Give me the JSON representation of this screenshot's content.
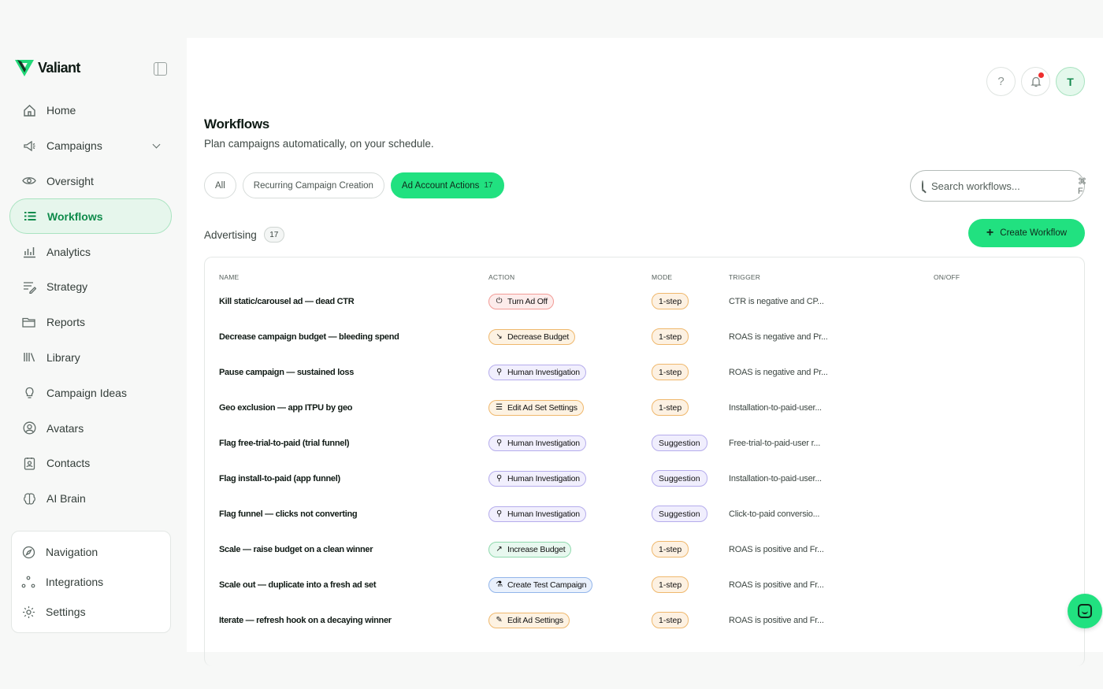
{
  "brand": {
    "name": "Valiant",
    "accent": "#21e180"
  },
  "sidebar": {
    "items": [
      {
        "label": "Home",
        "icon": "home-icon"
      },
      {
        "label": "Campaigns",
        "icon": "megaphone-icon"
      },
      {
        "label": "Oversight",
        "icon": "eye-icon"
      },
      {
        "label": "Workflows",
        "icon": "workflow-list-icon"
      },
      {
        "label": "Analytics",
        "icon": "bar-chart-icon"
      },
      {
        "label": "Strategy",
        "icon": "notes-pen-icon"
      },
      {
        "label": "Reports",
        "icon": "folder-icon"
      },
      {
        "label": "Library",
        "icon": "library-icon"
      },
      {
        "label": "Campaign Ideas",
        "icon": "lightbulb-icon"
      },
      {
        "label": "Avatars",
        "icon": "user-circle-icon"
      },
      {
        "label": "Contacts",
        "icon": "contact-card-icon"
      },
      {
        "label": "AI Brain",
        "icon": "brain-icon"
      }
    ],
    "bottom": [
      {
        "label": "Navigation",
        "icon": "compass-icon"
      },
      {
        "label": "Integrations",
        "icon": "nodes-icon"
      },
      {
        "label": "Settings",
        "icon": "gear-icon"
      }
    ]
  },
  "header": {
    "help": "?",
    "avatar_initial": "T"
  },
  "page": {
    "title": "Workflows",
    "subtitle": "Plan campaigns automatically, on your schedule."
  },
  "filters": [
    {
      "label": "All"
    },
    {
      "label": "Recurring Campaign Creation"
    },
    {
      "label": "Ad Account Actions",
      "count": "17"
    }
  ],
  "search": {
    "placeholder": "Search workflows...",
    "shortcut": "⌘ F"
  },
  "section": {
    "title": "Advertising",
    "count": "17"
  },
  "create_button": {
    "label": "Create Workflow"
  },
  "table": {
    "columns": [
      "NAME",
      "ACTION",
      "MODE",
      "TRIGGER",
      "ON/OFF"
    ],
    "rows": [
      {
        "name": "Kill static/carousel ad — dead CTR",
        "action": "Turn Ad Off",
        "action_icon": "power-off-icon",
        "mode": "1-step",
        "trigger": "CTR is negative and CP..."
      },
      {
        "name": "Decrease campaign budget — bleeding spend",
        "action": "Decrease Budget",
        "action_icon": "trend-down-icon",
        "mode": "1-step",
        "trigger": "ROAS is negative and Pr..."
      },
      {
        "name": "Pause campaign — sustained loss",
        "action": "Human Investigation",
        "action_icon": "search-icon",
        "mode": "1-step",
        "trigger": "ROAS is negative and Pr..."
      },
      {
        "name": "Geo exclusion — app ITPU by geo",
        "action": "Edit Ad Set Settings",
        "action_icon": "sliders-icon",
        "mode": "1-step",
        "trigger": "Installation-to-paid-user..."
      },
      {
        "name": "Flag free-trial-to-paid (trial funnel)",
        "action": "Human Investigation",
        "action_icon": "search-icon",
        "mode": "Suggestion",
        "trigger": "Free-trial-to-paid-user r..."
      },
      {
        "name": "Flag install-to-paid (app funnel)",
        "action": "Human Investigation",
        "action_icon": "search-icon",
        "mode": "Suggestion",
        "trigger": "Installation-to-paid-user..."
      },
      {
        "name": "Flag funnel — clicks not converting",
        "action": "Human Investigation",
        "action_icon": "search-icon",
        "mode": "Suggestion",
        "trigger": "Click-to-paid conversio..."
      },
      {
        "name": "Scale — raise budget on a clean winner",
        "action": "Increase Budget",
        "action_icon": "trend-up-icon",
        "mode": "1-step",
        "trigger": "ROAS is positive and Fr..."
      },
      {
        "name": "Scale out — duplicate into a fresh ad set",
        "action": "Create Test Campaign",
        "action_icon": "flask-icon",
        "mode": "1-step",
        "trigger": "ROAS is positive and Fr..."
      },
      {
        "name": "Iterate — refresh hook on a decaying winner",
        "action": "Edit Ad Settings",
        "action_icon": "pencil-icon",
        "mode": "1-step",
        "trigger": "ROAS is positive and Fr..."
      }
    ]
  }
}
